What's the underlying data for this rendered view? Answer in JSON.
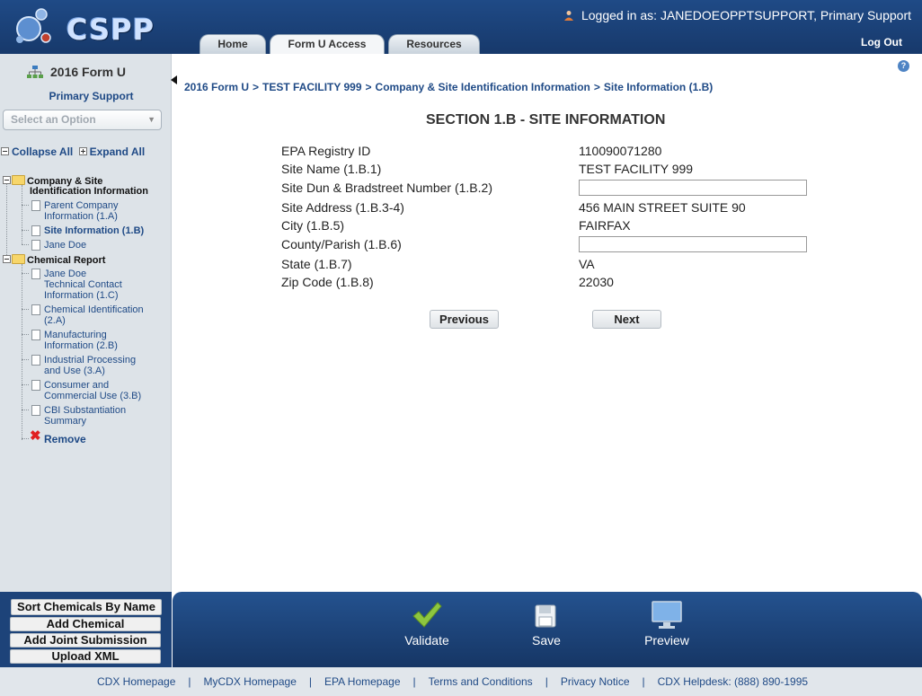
{
  "header": {
    "logo_text": "CSPP",
    "logged_in_label": "Logged in as:",
    "logged_in_user": "JANEDOEOPPTSUPPORT, Primary Support",
    "logout": "Log Out",
    "tabs": [
      {
        "label": "Home"
      },
      {
        "label": "Form U Access"
      },
      {
        "label": "Resources"
      }
    ]
  },
  "sidebar": {
    "title": "2016 Form U",
    "subtitle": "Primary Support",
    "select_placeholder": "Select an Option",
    "collapse_all": "Collapse All",
    "expand_all": "Expand All",
    "tree": {
      "company_folder_l1": "Company & Site",
      "company_folder_l2": "Identification Information",
      "parent_l1": "Parent Company",
      "parent_l2": "Information (1.A)",
      "site_info": "Site Information (1.B)",
      "jane_doe": "Jane Doe",
      "chemical_folder": "Chemical Report",
      "tech_l1": "Jane Doe",
      "tech_l2": "Technical Contact",
      "tech_l3": "Information (1.C)",
      "chemid_l1": "Chemical Identification",
      "chemid_l2": "(2.A)",
      "manuf_l1": "Manufacturing",
      "manuf_l2": "Information (2.B)",
      "indproc_l1": "Industrial Processing",
      "indproc_l2": "and Use (3.A)",
      "consumer_l1": "Consumer and",
      "consumer_l2": "Commercial Use (3.B)",
      "cbi_l1": "CBI Substantiation",
      "cbi_l2": "Summary",
      "remove": "Remove"
    },
    "buttons": {
      "sort": "Sort Chemicals By Name",
      "add_chemical": "Add Chemical",
      "add_joint": "Add Joint Submission",
      "upload_xml": "Upload XML"
    }
  },
  "main": {
    "breadcrumb": [
      "2016 Form U",
      "TEST FACILITY 999",
      "Company & Site Identification Information",
      "Site Information (1.B)"
    ],
    "breadcrumb_sep": ">",
    "help_glyph": "?",
    "section_title": "SECTION 1.B - SITE INFORMATION",
    "fields": [
      {
        "label": "EPA Registry ID",
        "value": "110090071280"
      },
      {
        "label": "Site Name (1.B.1)",
        "value": "TEST FACILITY 999"
      },
      {
        "label": "Site Dun & Bradstreet Number (1.B.2)",
        "value": ""
      },
      {
        "label": "Site Address (1.B.3-4)",
        "value": "456 MAIN STREET SUITE 90"
      },
      {
        "label": "City (1.B.5)",
        "value": "FAIRFAX"
      },
      {
        "label": "County/Parish (1.B.6)",
        "value": ""
      },
      {
        "label": "State (1.B.7)",
        "value": "VA"
      },
      {
        "label": "Zip Code (1.B.8)",
        "value": "22030"
      }
    ],
    "previous": "Previous",
    "next": "Next"
  },
  "actions": {
    "validate": "Validate",
    "save": "Save",
    "preview": "Preview"
  },
  "footer": {
    "links": [
      "CDX Homepage",
      "MyCDX Homepage",
      "EPA Homepage",
      "Terms and Conditions",
      "Privacy Notice",
      "CDX Helpdesk: (888) 890-1995"
    ],
    "separator": "|"
  },
  "colors": {
    "header_blue": "#1f4a86",
    "sidebar_bg": "#dde3e8",
    "link_blue": "#1f4a86",
    "validate_green": "#8dc63f",
    "remove_red": "#e02020"
  },
  "icons": {
    "logo": "cspp-molecule-logo",
    "user": "user-icon",
    "help": "help-icon",
    "tree": "org-tree-icon",
    "validate": "checkmark-icon",
    "save": "floppy-disk-icon",
    "preview": "monitor-icon"
  }
}
